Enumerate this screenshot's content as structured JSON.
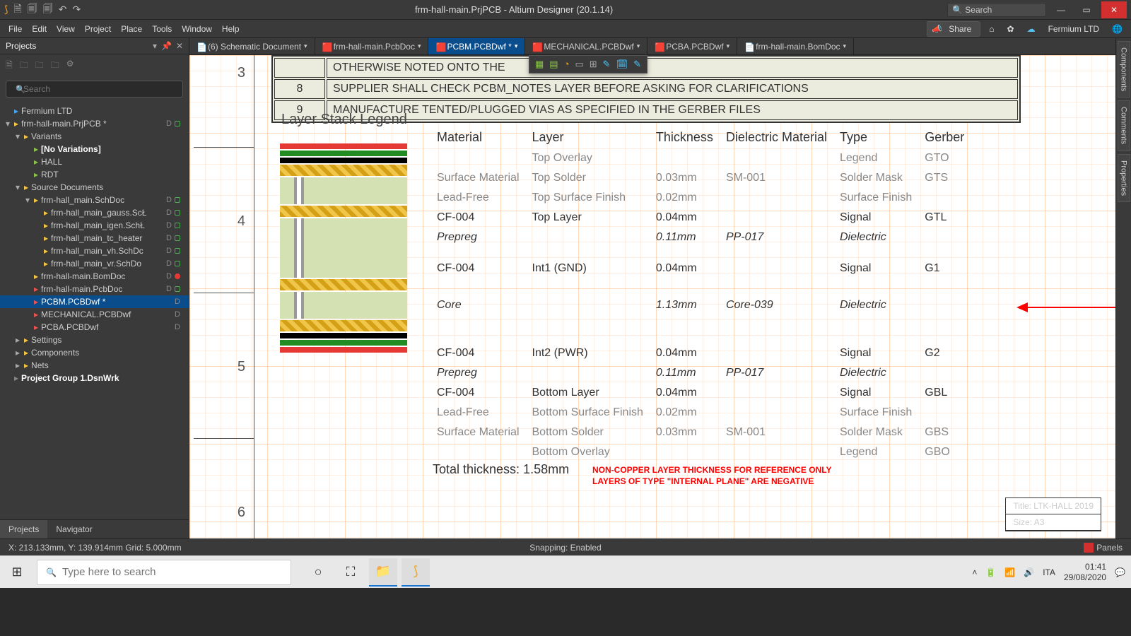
{
  "titlebar": {
    "title": "frm-hall-main.PrjPCB - Altium Designer (20.1.14)",
    "search_placeholder": "Search"
  },
  "menubar": {
    "items": [
      "File",
      "Edit",
      "View",
      "Project",
      "Place",
      "Tools",
      "Window",
      "Help"
    ],
    "share": "Share",
    "company": "Fermium LTD"
  },
  "projects": {
    "title": "Projects",
    "search_placeholder": "Search",
    "footer": [
      "Projects",
      "Navigator"
    ],
    "tree": [
      {
        "d": 0,
        "arr": "",
        "ic": "icn-db",
        "label": "Fermium LTD"
      },
      {
        "d": 0,
        "arr": "▾",
        "ic": "icn-y",
        "label": "frm-hall-main.PrjPCB *",
        "stat": "dg",
        "dl": "D"
      },
      {
        "d": 1,
        "arr": "▾",
        "ic": "icn-y",
        "label": "Variants"
      },
      {
        "d": 2,
        "arr": "",
        "ic": "icn-g",
        "label": "[No Variations]",
        "bold": true
      },
      {
        "d": 2,
        "arr": "",
        "ic": "icn-g",
        "label": "HALL"
      },
      {
        "d": 2,
        "arr": "",
        "ic": "icn-g",
        "label": "RDT"
      },
      {
        "d": 1,
        "arr": "▾",
        "ic": "icn-y",
        "label": "Source Documents"
      },
      {
        "d": 2,
        "arr": "▾",
        "ic": "icn-y",
        "label": "frm-hall_main.SchDoc",
        "stat": "dg",
        "dl": "D"
      },
      {
        "d": 3,
        "arr": "",
        "ic": "icn-y",
        "label": "frm-hall_main_gauss.ScŁ",
        "stat": "dg",
        "dl": "D"
      },
      {
        "d": 3,
        "arr": "",
        "ic": "icn-y",
        "label": "frm-hall_main_igen.SchŁ",
        "stat": "dg",
        "dl": "D"
      },
      {
        "d": 3,
        "arr": "",
        "ic": "icn-y",
        "label": "frm-hall_main_tc_heater",
        "stat": "dg",
        "dl": "D"
      },
      {
        "d": 3,
        "arr": "",
        "ic": "icn-y",
        "label": "frm-hall_main_vh.SchDc",
        "stat": "dg",
        "dl": "D"
      },
      {
        "d": 3,
        "arr": "",
        "ic": "icn-y",
        "label": "frm-hall_main_vr.SchDo",
        "stat": "dg",
        "dl": "D"
      },
      {
        "d": 2,
        "arr": "",
        "ic": "icn-y",
        "label": "frm-hall-main.BomDoc",
        "stat": "dr",
        "dl": "D"
      },
      {
        "d": 2,
        "arr": "",
        "ic": "icn-r",
        "label": "frm-hall-main.PcbDoc",
        "stat": "dg",
        "dl": "D"
      },
      {
        "d": 2,
        "arr": "",
        "ic": "icn-r",
        "label": "PCBM.PCBDwf *",
        "sel": true,
        "dl": "D"
      },
      {
        "d": 2,
        "arr": "",
        "ic": "icn-r",
        "label": "MECHANICAL.PCBDwf",
        "dl": "D"
      },
      {
        "d": 2,
        "arr": "",
        "ic": "icn-r",
        "label": "PCBA.PCBDwf",
        "dl": "D"
      },
      {
        "d": 1,
        "arr": "▸",
        "ic": "icn-y",
        "label": "Settings"
      },
      {
        "d": 1,
        "arr": "▸",
        "ic": "icn-y",
        "label": "Components"
      },
      {
        "d": 1,
        "arr": "▸",
        "ic": "icn-y",
        "label": "Nets"
      },
      {
        "d": 0,
        "arr": "",
        "ic": "icn-gray",
        "label": "Project Group 1.DsnWrk",
        "bold": true
      }
    ]
  },
  "doctabs": [
    {
      "label": "(6) Schematic Document",
      "ic": "📄"
    },
    {
      "label": "frm-hall-main.PcbDoc",
      "ic": "🟥"
    },
    {
      "label": "PCBM.PCBDwf *",
      "ic": "🟥",
      "active": true
    },
    {
      "label": "MECHANICAL.PCBDwf",
      "ic": "🟥"
    },
    {
      "label": "PCBA.PCBDwf",
      "ic": "🟥"
    },
    {
      "label": "frm-hall-main.BomDoc",
      "ic": "📄"
    }
  ],
  "notes": {
    "rows": [
      {
        "n": "",
        "t": "OTHERWISE NOTED ONTO THE"
      },
      {
        "n": "8",
        "t": "SUPPLIER SHALL CHECK PCBM_NOTES LAYER BEFORE ASKING FOR CLARIFICATIONS"
      },
      {
        "n": "9",
        "t": "MANUFACTURE TENTED/PLUGGED VIAS AS SPECIFIED IN THE GERBER FILES"
      }
    ]
  },
  "stack": {
    "title": "Layer Stack Legend",
    "headers": [
      "Material",
      "Layer",
      "Thickness",
      "Dielectric Material",
      "Type",
      "Gerber"
    ],
    "rows": [
      {
        "m": "",
        "l": "Top Overlay",
        "th": "",
        "d": "",
        "ty": "Legend",
        "g": "GTO"
      },
      {
        "m": "Surface Material",
        "l": "Top Solder",
        "th": "0.03mm",
        "d": "SM-001",
        "ty": "Solder Mask",
        "g": "GTS"
      },
      {
        "m": "Lead-Free",
        "l": "Top Surface Finish",
        "th": "0.02mm",
        "d": "",
        "ty": "Surface Finish",
        "g": ""
      },
      {
        "m": "CF-004",
        "l": "Top Layer",
        "th": "0.04mm",
        "d": "",
        "ty": "Signal",
        "g": "GTL",
        "blk": true
      },
      {
        "m": "Prepreg",
        "l": "",
        "th": "0.11mm",
        "d": "PP-017",
        "ty": "Dielectric",
        "g": "",
        "blk": true,
        "it": true
      },
      {
        "m": "CF-004",
        "l": "Int1 (GND)",
        "th": "0.04mm",
        "d": "",
        "ty": "Signal",
        "g": "G1",
        "blk": true,
        "sp": true
      },
      {
        "m": "Core",
        "l": "",
        "th": "1.13mm",
        "d": "Core-039",
        "ty": "Dielectric",
        "g": "",
        "blk": true,
        "it": true,
        "tall": true
      },
      {
        "m": "CF-004",
        "l": "Int2 (PWR)",
        "th": "0.04mm",
        "d": "",
        "ty": "Signal",
        "g": "G2",
        "blk": true,
        "sp": true
      },
      {
        "m": "Prepreg",
        "l": "",
        "th": "0.11mm",
        "d": "PP-017",
        "ty": "Dielectric",
        "g": "",
        "blk": true,
        "it": true
      },
      {
        "m": "CF-004",
        "l": "Bottom Layer",
        "th": "0.04mm",
        "d": "",
        "ty": "Signal",
        "g": "GBL",
        "blk": true
      },
      {
        "m": "Lead-Free",
        "l": "Bottom Surface Finish",
        "th": "0.02mm",
        "d": "",
        "ty": "Surface Finish",
        "g": ""
      },
      {
        "m": "Surface Material",
        "l": "Bottom Solder",
        "th": "0.03mm",
        "d": "SM-001",
        "ty": "Solder Mask",
        "g": "GBS"
      },
      {
        "m": "",
        "l": "Bottom Overlay",
        "th": "",
        "d": "",
        "ty": "Legend",
        "g": "GBO"
      }
    ],
    "total": "Total thickness: 1.58mm"
  },
  "rednote": {
    "l1": "NON-COPPER LAYER THICKNESS FOR REFERENCE ONLY",
    "l2": "LAYERS OF TYPE \"INTERNAL PLANE\" ARE NEGATIVE"
  },
  "titleblock": {
    "title": "Title: LTK-HALL 2019",
    "size": "Size: A3"
  },
  "gutters": [
    "3",
    "4",
    "5",
    "6"
  ],
  "rside": [
    "Components",
    "Comments",
    "Properties"
  ],
  "status": {
    "coords": "X: 213.133mm, Y: 139.914mm   Grid: 5.000mm",
    "snap": "Snapping: Enabled",
    "panels": "Panels"
  },
  "taskbar": {
    "search_placeholder": "Type here to search",
    "lang": "ITA",
    "time": "01:41",
    "date": "29/08/2020"
  }
}
